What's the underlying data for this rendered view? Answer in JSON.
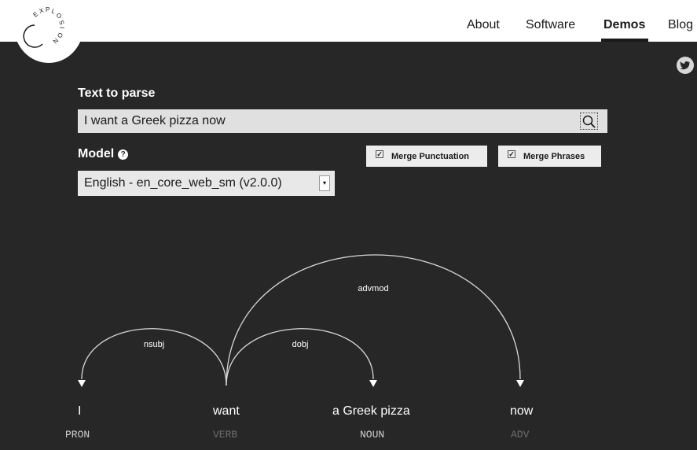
{
  "brand": {
    "logo_text": "EXPLOSION"
  },
  "nav": {
    "items": [
      {
        "label": "About",
        "active": false
      },
      {
        "label": "Software",
        "active": false
      },
      {
        "label": "Demos",
        "active": true
      },
      {
        "label": "Blog",
        "active": false
      }
    ]
  },
  "social": {
    "icon": "twitter-icon"
  },
  "form": {
    "text_label": "Text to parse",
    "text_value": "I want a Greek pizza now",
    "model_label": "Model",
    "model_help": "?",
    "model_selected": "English - en_core_web_sm (v2.0.0)",
    "merge_punctuation": {
      "label": "Merge Punctuation",
      "checked": true
    },
    "merge_phrases": {
      "label": "Merge Phrases",
      "checked": true
    }
  },
  "parse": {
    "words": [
      {
        "text": "I",
        "tag": "PRON"
      },
      {
        "text": "want",
        "tag": "VERB"
      },
      {
        "text": "a Greek pizza",
        "tag": "NOUN"
      },
      {
        "text": "now",
        "tag": "ADV"
      }
    ],
    "arcs": [
      {
        "label": "nsubj",
        "from": 1,
        "to": 0
      },
      {
        "label": "dobj",
        "from": 1,
        "to": 2
      },
      {
        "label": "advmod",
        "from": 1,
        "to": 3
      }
    ]
  },
  "colors": {
    "background": "#272727",
    "topbar": "#ffffff",
    "tag_bright": "#cfcfcf",
    "tag_dim": "#6d6d6d"
  }
}
